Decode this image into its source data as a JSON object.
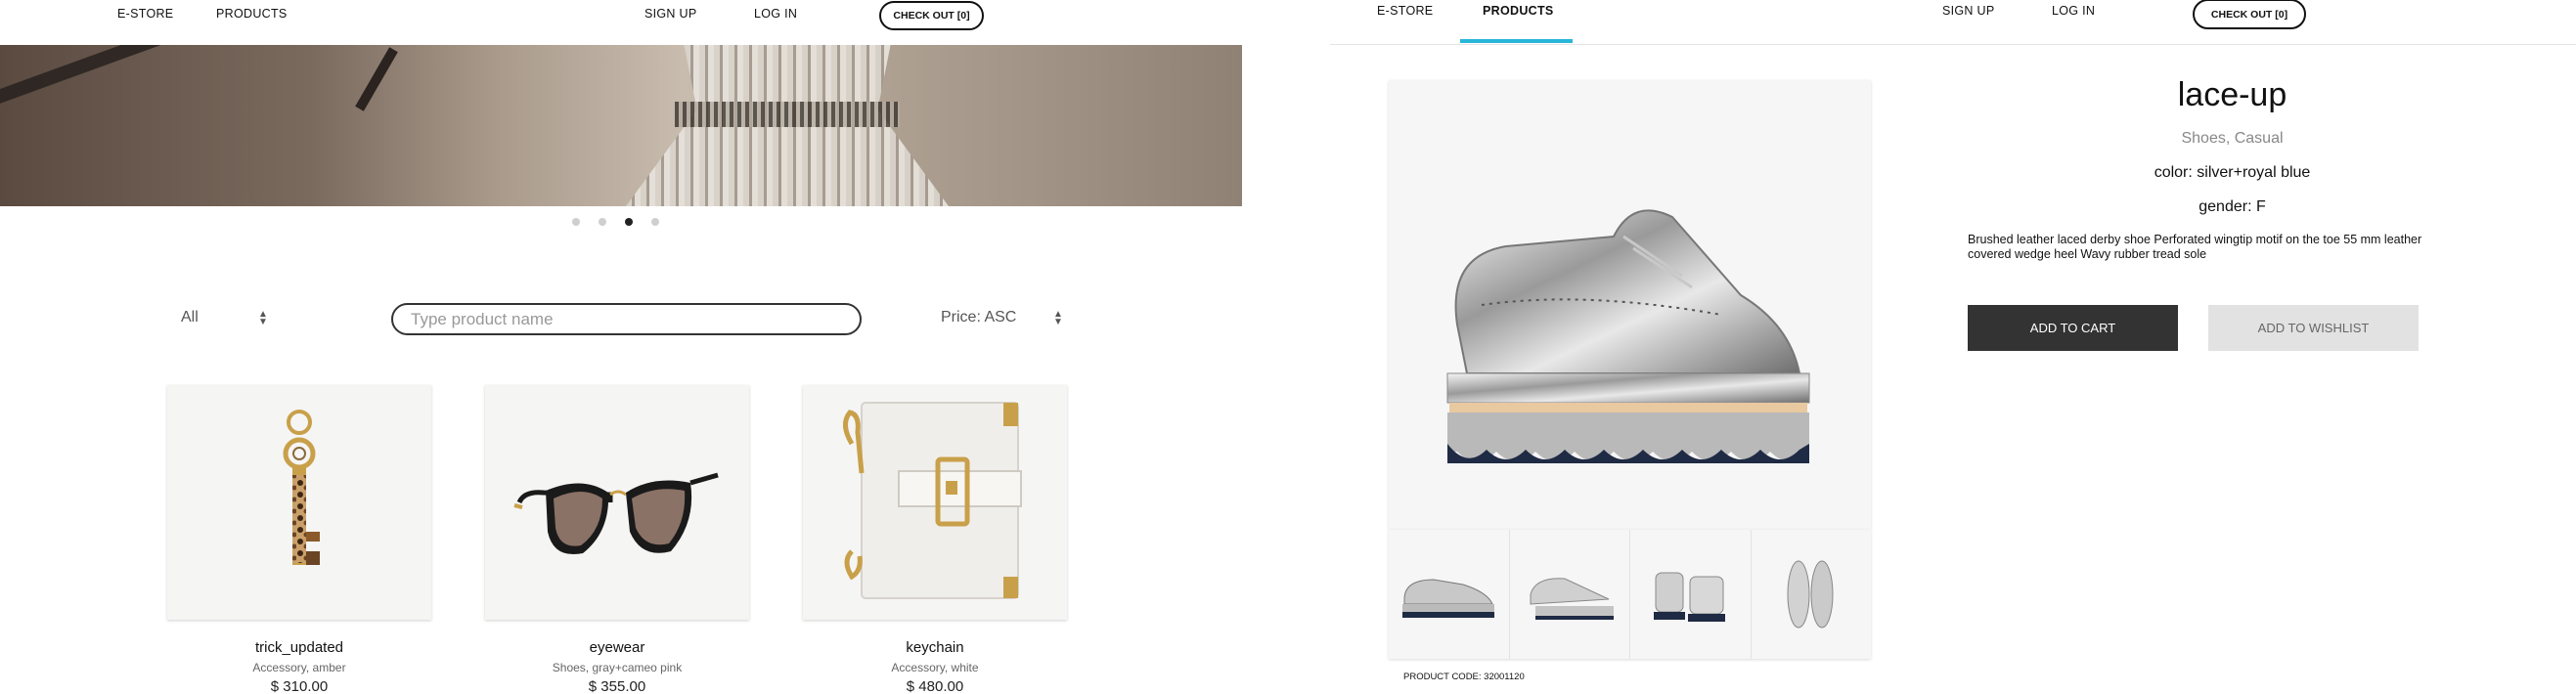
{
  "left_panel": {
    "nav": {
      "estore": "E-STORE",
      "products": "PRODUCTS",
      "signup": "SIGN UP",
      "login": "LOG IN",
      "checkout": "CHECK OUT [0]"
    },
    "carousel": {
      "dot_count": 4,
      "active_index": 2
    },
    "filters": {
      "category_value": "All",
      "search_placeholder": "Type product name",
      "sort_value": "Price: ASC"
    },
    "products": [
      {
        "name": "trick_updated",
        "subtitle": "Accessory, amber",
        "price": "$ 310.00",
        "icon": "key-charm-icon"
      },
      {
        "name": "eyewear",
        "subtitle": "Shoes, gray+cameo pink",
        "price": "$ 355.00",
        "icon": "sunglasses-icon"
      },
      {
        "name": "keychain",
        "subtitle": "Accessory, white",
        "price": "$ 480.00",
        "icon": "white-bag-icon"
      }
    ]
  },
  "right_panel": {
    "nav": {
      "estore": "E-STORE",
      "products": "PRODUCTS",
      "signup": "SIGN UP",
      "login": "LOG IN",
      "checkout": "CHECK OUT [0]"
    },
    "product": {
      "title": "lace-up",
      "category": "Shoes, Casual",
      "color": "color: silver+royal blue",
      "gender": "gender: F",
      "description": "Brushed leather laced derby shoe Perforated wingtip motif on the toe 55 mm leather covered wedge heel Wavy rubber tread sole",
      "add_to_cart": "ADD TO CART",
      "add_to_wishlist": "ADD TO WISHLIST",
      "product_code": "PRODUCT CODE: 32001120"
    }
  },
  "colors": {
    "active_tab_underline": "#29b6d8",
    "cart_button": "#333333",
    "wishlist_button": "#e2e2e2"
  }
}
